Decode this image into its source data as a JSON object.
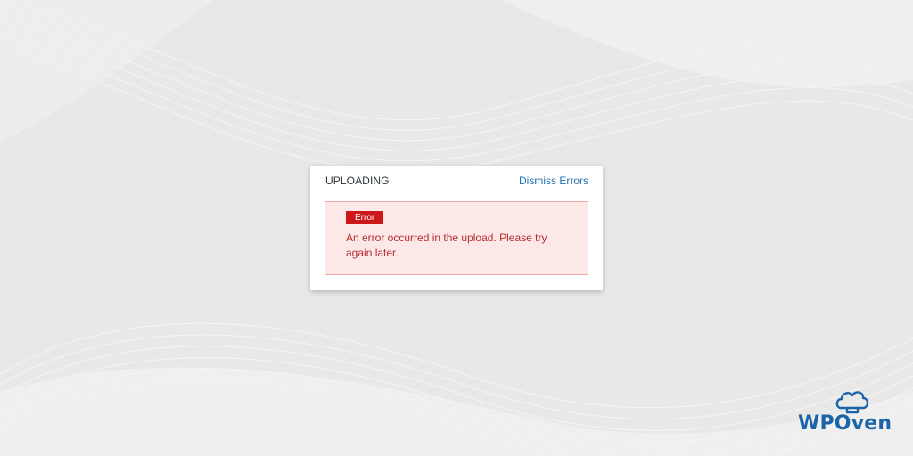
{
  "dialog": {
    "title": "UPLOADING",
    "dismiss_label": "Dismiss Errors",
    "error": {
      "badge": "Error",
      "message": "An error occurred in the upload. Please try again later."
    }
  },
  "brand": {
    "name": "WPOven",
    "icon": "chef-hat-icon",
    "color": "#1b64a8"
  },
  "colors": {
    "error_red": "#cc1818",
    "error_text": "#b32d2e",
    "error_bg": "#fde8e8",
    "link_blue": "#2271b1"
  }
}
